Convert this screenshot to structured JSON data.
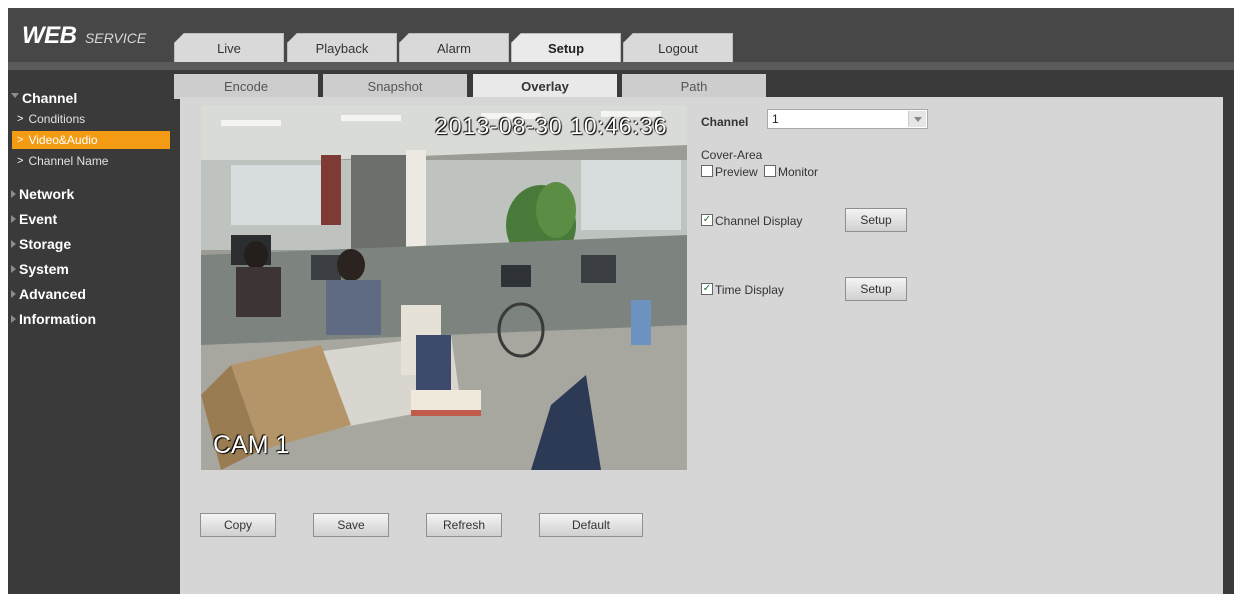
{
  "header": {
    "logo_main": "WEB",
    "logo_sub": "SERVICE",
    "tabs": [
      {
        "label": "Live"
      },
      {
        "label": "Playback"
      },
      {
        "label": "Alarm"
      },
      {
        "label": "Setup"
      },
      {
        "label": "Logout"
      }
    ],
    "active_tab": "Setup"
  },
  "sidebar": {
    "groups": [
      {
        "label": "Channel",
        "expanded": true,
        "items": [
          {
            "label": "Conditions"
          },
          {
            "label": "Video&Audio",
            "active": true
          },
          {
            "label": "Channel Name"
          }
        ]
      },
      {
        "label": "Network"
      },
      {
        "label": "Event"
      },
      {
        "label": "Storage"
      },
      {
        "label": "System"
      },
      {
        "label": "Advanced"
      },
      {
        "label": "Information"
      }
    ]
  },
  "subtabs": [
    {
      "label": "Encode"
    },
    {
      "label": "Snapshot"
    },
    {
      "label": "Overlay",
      "active": true
    },
    {
      "label": "Path"
    }
  ],
  "preview": {
    "timestamp": "2013-08-30 10:46:36",
    "camera_name": "CAM 1"
  },
  "form": {
    "channel_label": "Channel",
    "channel_value": "1",
    "cover_area_label": "Cover-Area",
    "preview_label": "Preview",
    "monitor_label": "Monitor",
    "preview_checked": false,
    "monitor_checked": false,
    "channel_display_label": "Channel Display",
    "channel_display_checked": true,
    "time_display_label": "Time Display",
    "time_display_checked": true,
    "setup_label": "Setup",
    "check_glyph": "✓"
  },
  "actions": {
    "copy": "Copy",
    "save": "Save",
    "refresh": "Refresh",
    "default": "Default"
  },
  "colors": {
    "accent": "#f39b12",
    "sidebar_bg": "#3a3a3a",
    "panel_bg": "#d6d6d6"
  }
}
